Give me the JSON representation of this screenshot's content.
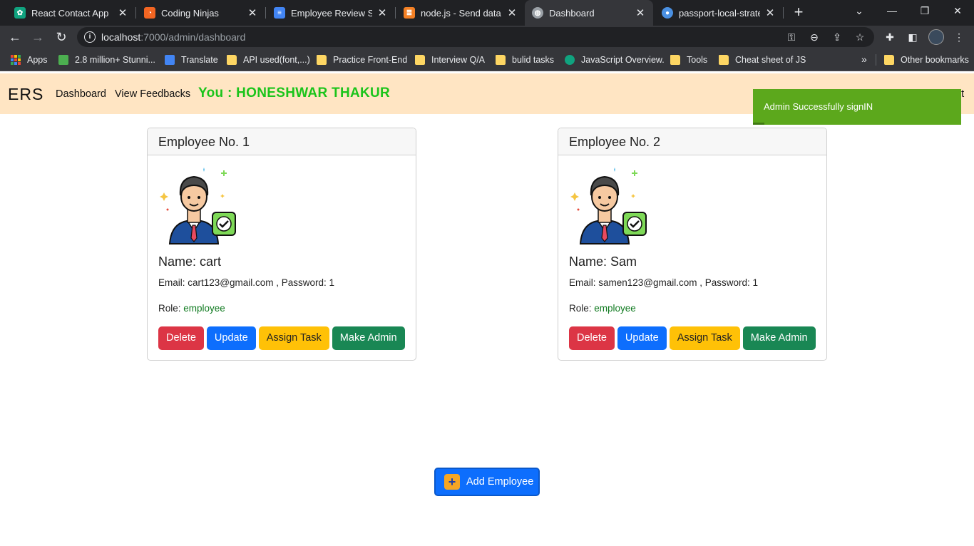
{
  "browser": {
    "tabs": [
      {
        "label": "React Contact App",
        "icon": "openai-icon",
        "color": "#10a37f"
      },
      {
        "label": "Coding Ninjas",
        "icon": "coding-ninjas-icon",
        "color": "#f26522"
      },
      {
        "label": "Employee Review Syst",
        "icon": "google-docs-icon",
        "color": "#4285f4"
      },
      {
        "label": "node.js - Send data ba",
        "icon": "stackoverflow-icon",
        "color": "#f48024"
      },
      {
        "label": "Dashboard",
        "icon": "globe-icon",
        "color": "#9aa0a6"
      },
      {
        "label": "passport-local-strateg",
        "icon": "github-icon",
        "color": "#4a90e2"
      }
    ],
    "address": {
      "host": "localhost",
      "rest": ":7000/admin/dashboard"
    },
    "bookmarks": [
      {
        "label": "Apps",
        "type": "apps"
      },
      {
        "label": "2.8 million+ Stunni...",
        "type": "px",
        "color": "#4caf50"
      },
      {
        "label": "Translate",
        "type": "translate",
        "color": "#4285f4"
      },
      {
        "label": "API used(font,...)",
        "type": "folder"
      },
      {
        "label": "Practice Front-End",
        "type": "folder"
      },
      {
        "label": "Interview Q/A",
        "type": "folder"
      },
      {
        "label": "bulid tasks",
        "type": "folder"
      },
      {
        "label": "JavaScript Overview.",
        "type": "openai",
        "color": "#10a37f"
      },
      {
        "label": "Tools",
        "type": "folder"
      },
      {
        "label": "Cheat sheet of JS",
        "type": "folder"
      }
    ],
    "more_bookmarks": "»",
    "other_bookmarks": "Other bookmarks"
  },
  "nav": {
    "brand": "ERS",
    "links": [
      "Dashboard",
      "View Feedbacks"
    ],
    "you_label": "You :  HONESHWAR THAKUR",
    "logout_peek": "ut"
  },
  "toast": {
    "message": "Admin Successfully signIN"
  },
  "employees": [
    {
      "header": "Employee No. 1",
      "name": "Name: cart",
      "email_line": "Email: cart123@gmail.com , Password: 1",
      "role_label": "Role: ",
      "role_value": "employee"
    },
    {
      "header": "Employee No. 2",
      "name": "Name: Sam",
      "email_line": "Email: samen123@gmail.com , Password: 1",
      "role_label": "Role: ",
      "role_value": "employee"
    }
  ],
  "actions": {
    "delete": "Delete",
    "update": "Update",
    "assign": "Assign Task",
    "make_admin": "Make Admin"
  },
  "add_button": {
    "label": "Add Employee",
    "icon": "plus-icon"
  },
  "colors": {
    "navbar_bg": "#ffe5c3",
    "toast_bg": "#5ca81c",
    "delete": "#dc3545",
    "update": "#0d6efd",
    "assign": "#ffc107",
    "make_admin": "#198754",
    "you_label": "#1bc41b"
  }
}
